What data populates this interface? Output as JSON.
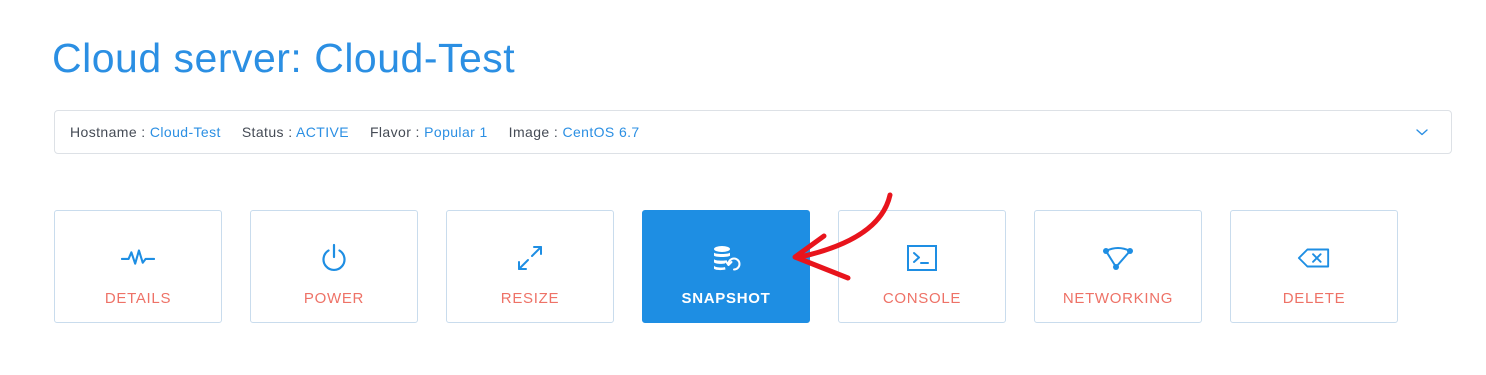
{
  "page": {
    "title": "Cloud server: Cloud-Test"
  },
  "info_bar": {
    "items": [
      {
        "label": "Hostname : ",
        "value": "Cloud-Test"
      },
      {
        "label": "Status : ",
        "value": "ACTIVE"
      },
      {
        "label": "Flavor : ",
        "value": "Popular 1"
      },
      {
        "label": "Image : ",
        "value": "CentOS 6.7"
      }
    ],
    "toggle_icon": "chevron-down-icon"
  },
  "actions": [
    {
      "label": "DETAILS",
      "icon": "pulse-icon"
    },
    {
      "label": "POWER",
      "icon": "power-icon"
    },
    {
      "label": "RESIZE",
      "icon": "resize-arrows-icon"
    },
    {
      "label": "SNAPSHOT",
      "icon": "database-restore-icon",
      "active": true
    },
    {
      "label": "CONSOLE",
      "icon": "terminal-icon"
    },
    {
      "label": "NETWORKING",
      "icon": "network-nodes-icon"
    },
    {
      "label": "DELETE",
      "icon": "backspace-delete-icon"
    }
  ],
  "annotation": {
    "icon": "red-arrow-icon",
    "color": "#e8141c"
  },
  "colors": {
    "accent": "#2b8fe3",
    "active_tile": "#1e8ee3",
    "action_label": "#ee7267",
    "tile_border": "#c9dced"
  }
}
